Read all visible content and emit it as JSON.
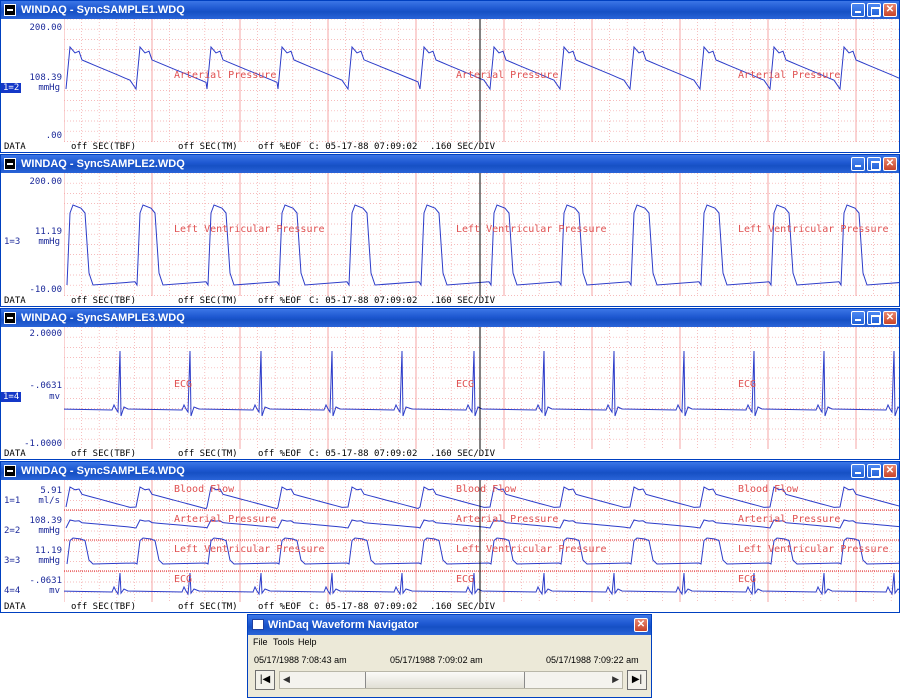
{
  "colors": {
    "title_blue": "#1d57d0",
    "trace": "#2c3cc9",
    "grid": "#f4a6a6",
    "grid_dot": "#f08b8b",
    "channel_label": "#e04040",
    "cursor": "#000000",
    "threshold": "#e02020"
  },
  "status_bar": {
    "data": "DATA",
    "tbf": "off SEC(TBF)",
    "tm": "off SEC(TM)",
    "eof": "off %EOF",
    "cursor_time": "C: 05-17-88 07:09:02",
    "div": ".160 SEC/DIV"
  },
  "windows": [
    {
      "title": "WINDAQ - SyncSAMPLE1.WDQ",
      "scale": [
        {
          "top": "200.00",
          "mid": "108.39",
          "unit": "mmHg",
          "bottom": ".00",
          "channel": "1=2",
          "selected": true
        }
      ],
      "trace_label": "Arterial Pressure"
    },
    {
      "title": "WINDAQ - SyncSAMPLE2.WDQ",
      "scale": [
        {
          "top": "200.00",
          "mid": "11.19",
          "unit": "mmHg",
          "bottom": "-10.00",
          "channel": "1=3",
          "selected": false
        }
      ],
      "trace_label": "Left Ventricular Pressure"
    },
    {
      "title": "WINDAQ - SyncSAMPLE3.WDQ",
      "scale": [
        {
          "top": "2.0000",
          "mid": "-.0631",
          "unit": "mv",
          "bottom": "-1.0000",
          "channel": "1=4",
          "selected": true
        }
      ],
      "trace_label": "ECG"
    },
    {
      "title": "WINDAQ - SyncSAMPLE4.WDQ",
      "channels": [
        {
          "mid": "5.91",
          "unit": "ml/s",
          "channel": "1=1",
          "label": "Blood Flow"
        },
        {
          "mid": "108.39",
          "unit": "mmHg",
          "channel": "2=2",
          "label": "Arterial Pressure"
        },
        {
          "mid": "11.19",
          "unit": "mmHg",
          "channel": "3=3",
          "label": "Left Ventricular Pressure"
        },
        {
          "mid": "-.0631",
          "unit": "mv",
          "channel": "4=4",
          "label": "ECG"
        }
      ]
    }
  ],
  "navigator": {
    "title": "WinDaq Waveform Navigator",
    "menu": [
      "File",
      "Tools",
      "Help"
    ],
    "time_start": "05/17/1988 7:08:43 am",
    "time_cursor": "05/17/1988 7:09:02 am",
    "time_end": "05/17/1988 7:09:22 am",
    "first_button": "|◀",
    "last_button": "▶|",
    "scroll_position": 0.46
  }
}
